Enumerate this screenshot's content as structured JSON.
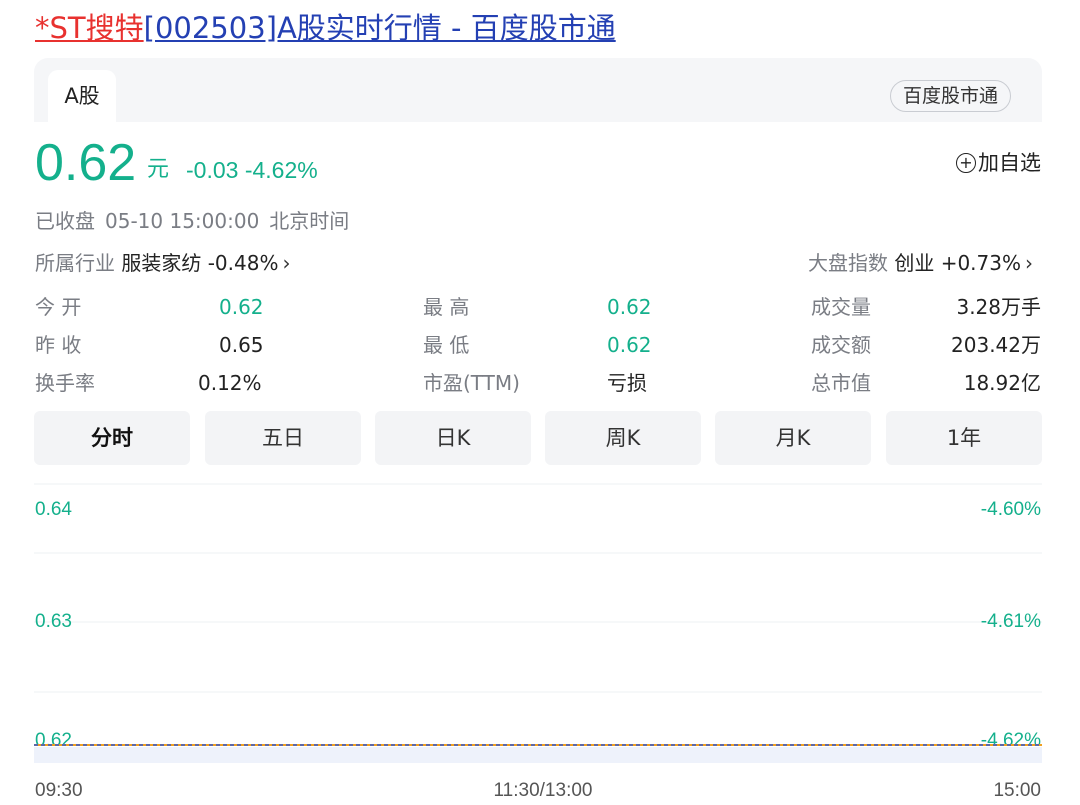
{
  "title": {
    "prefix": "*ST搜特",
    "rest": "[002503]A股实时行情 - 百度股市通"
  },
  "tabs": {
    "active": "A股",
    "brand": "百度股市通"
  },
  "quote": {
    "price": "0.62",
    "unit": "元",
    "change": "-0.03 -4.62%",
    "add_watchlist": "加自选",
    "status": "已收盘",
    "datetime": "05-10 15:00:00",
    "timezone": "北京时间",
    "industry_label": "所属行业",
    "industry_value": "服装家纺 -0.48%",
    "index_label": "大盘指数",
    "index_value": "创业 +0.73%"
  },
  "stats": {
    "open_label": "今 开",
    "open": "0.62",
    "high_label": "最 高",
    "high": "0.62",
    "volume_label": "成交量",
    "volume": "3.28万手",
    "prev_close_label": "昨 收",
    "prev_close": "0.65",
    "low_label": "最 低",
    "low": "0.62",
    "amount_label": "成交额",
    "amount": "203.42万",
    "turnover_label": "换手率",
    "turnover": "0.12%",
    "pe_label": "市盈(TTM)",
    "pe": "亏损",
    "mcap_label": "总市值",
    "mcap": "18.92亿"
  },
  "periods": [
    "分时",
    "五日",
    "日K",
    "周K",
    "月K",
    "1年"
  ],
  "colors": {
    "down": "#14b08c",
    "up": "#e8312f",
    "link": "#2440b3",
    "price_line": "#2b56d6",
    "avg_line": "#f0a020"
  },
  "chart_data": {
    "type": "line",
    "y_ticks": [
      "0.64",
      "0.63",
      "0.62"
    ],
    "y_right_ticks": [
      "-4.60%",
      "-4.61%",
      "-4.62%"
    ],
    "x_ticks": [
      "09:30",
      "11:30/13:00",
      "15:00"
    ],
    "ylim": [
      0.62,
      0.64
    ],
    "series": [
      {
        "values": [
          0.62,
          0.62,
          0.62,
          0.62,
          0.62
        ]
      }
    ]
  }
}
